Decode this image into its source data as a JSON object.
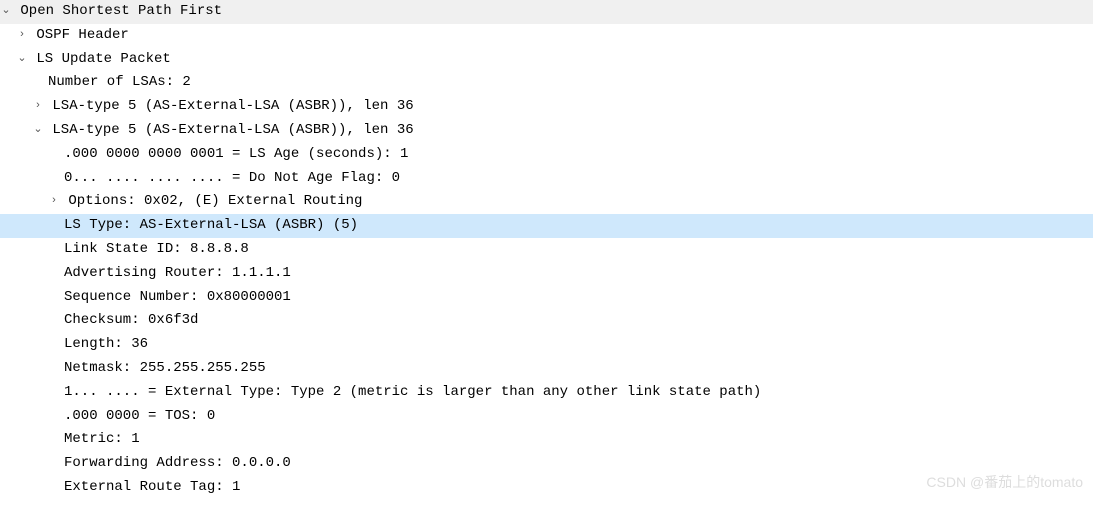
{
  "protocol": {
    "name": "Open Shortest Path First",
    "header": "OSPF Header",
    "update_packet": {
      "label": "LS Update Packet",
      "num_lsas": "Number of LSAs: 2",
      "lsa1": "LSA-type 5 (AS-External-LSA (ASBR)), len 36",
      "lsa2": {
        "label": "LSA-type 5 (AS-External-LSA (ASBR)), len 36",
        "ls_age": ".000 0000 0000 0001 = LS Age (seconds): 1",
        "do_not_age": "0... .... .... .... = Do Not Age Flag: 0",
        "options": "Options: 0x02, (E) External Routing",
        "ls_type": "LS Type: AS-External-LSA (ASBR) (5)",
        "link_state_id": "Link State ID: 8.8.8.8",
        "adv_router": "Advertising Router: 1.1.1.1",
        "seq_num": "Sequence Number: 0x80000001",
        "checksum": "Checksum: 0x6f3d",
        "length": "Length: 36",
        "netmask": "Netmask: 255.255.255.255",
        "ext_type": "1... .... = External Type: Type 2 (metric is larger than any other link state path)",
        "tos": ".000 0000 = TOS: 0",
        "metric": "Metric: 1",
        "fwd_addr": "Forwarding Address: 0.0.0.0",
        "ext_route_tag": "External Route Tag: 1"
      }
    }
  },
  "watermark": "CSDN @番茄上的tomato"
}
